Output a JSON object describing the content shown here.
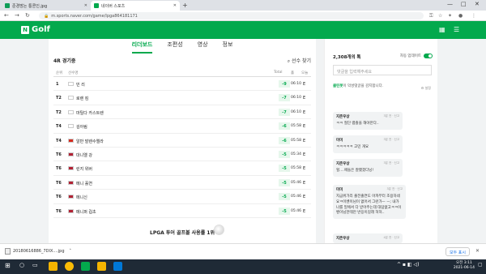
{
  "browser": {
    "tabs": [
      {
        "title": "준경방는 통쿵인.jpg",
        "favicon_color": "#0f9d58"
      },
      {
        "title": "네이버 스포츠",
        "favicon_color": "#03a94d"
      }
    ],
    "new_tab": "+",
    "url": "m.sports.naver.com/game/lpga864181171",
    "window": {
      "minimize": "—",
      "maximize": "□",
      "close": "✕"
    }
  },
  "site": {
    "logo_letter": "N",
    "logo_text": "Golf",
    "icons": [
      "calendar-icon",
      "menu-icon"
    ]
  },
  "page_tabs": [
    {
      "label": "리더보드",
      "active": true
    },
    {
      "label": "조편성",
      "active": false
    },
    {
      "label": "영상",
      "active": false
    },
    {
      "label": "정보",
      "active": false
    }
  ],
  "leaderboard": {
    "round_label": "4R 경기중",
    "find_button": "선수 찾기",
    "columns": {
      "pos": "순위",
      "player": "선수명",
      "total": "Total",
      "thru": "홀",
      "last": "오늘"
    },
    "rows": [
      {
        "pos": "1",
        "flag": "kr",
        "name": "민 리",
        "score": "-9",
        "thru": "06:10",
        "last": "E"
      },
      {
        "pos": "T2",
        "flag": "kr",
        "name": "로렌 킴",
        "score": "-7",
        "thru": "06:10",
        "last": "E"
      },
      {
        "pos": "T2",
        "flag": "fi",
        "name": "마틸다 카스트렌",
        "score": "-7",
        "thru": "06:10",
        "last": "E"
      },
      {
        "pos": "T4",
        "flag": "kr",
        "name": "김아림",
        "score": "-6",
        "thru": "05:58",
        "last": "E"
      },
      {
        "pos": "T4",
        "flag": "ch",
        "name": "알반 발렌수엘라",
        "score": "-6",
        "thru": "05:58",
        "last": "E"
      },
      {
        "pos": "T6",
        "flag": "us",
        "name": "대니엘 강",
        "score": "-5",
        "thru": "05:34",
        "last": "E"
      },
      {
        "pos": "T6",
        "flag": "us",
        "name": "린지 위버",
        "score": "-5",
        "thru": "05:58",
        "last": "E"
      },
      {
        "pos": "T6",
        "flag": "us",
        "name": "메니 홀연",
        "score": "-5",
        "thru": "05:46",
        "last": "E"
      },
      {
        "pos": "T6",
        "flag": "us",
        "name": "메니신",
        "score": "-5",
        "thru": "05:46",
        "last": "E"
      },
      {
        "pos": "T6",
        "flag": "us",
        "name": "메니퍼 컵초",
        "score": "-5",
        "thru": "05:46",
        "last": "E"
      }
    ],
    "banner": "LPGA 투어 골프볼 사용률 1위"
  },
  "chat": {
    "count": "2,308개의 톡",
    "autoscroll_label": "자동 업데이트",
    "input_placeholder": "댓글을 입력해주세요",
    "cleanbot_name": "클린봇",
    "cleanbot_text": "이 악성댓글을 감지합니다.",
    "cleanbot_setting": "설정",
    "comments": [
      {
        "nick": "지존우상",
        "meta": "3분 전 · 신고",
        "text": "ㅋㅋ 절단 램즐을 해야한다.."
      },
      {
        "nick": "미미",
        "meta": "3분 전 · 신고",
        "text": "ㅋㅋㅋㅋㅋ 고민 개요"
      },
      {
        "nick": "지존우상",
        "meta": "3분 전 · 신고",
        "text": "헐....애들은 잘했겠다닝!"
      },
      {
        "nick": "미미",
        "meta": "3분 전 · 신고",
        "text": "지금위가리 출전출연도 아까부터 조용하네요ㅋ이벤이님이 없어서 그런가ㅡ ㅡ; 내가 나를 밑에서 다 받아주는데 대답없고ㅋㅋ이벤이님한테만 반응이길래 허허.."
      },
      {
        "nick": "지존우상",
        "meta": "4분 전 · 신고",
        "text": ""
      }
    ]
  },
  "downloads": {
    "file": "20180616886_7DIX....jpg",
    "show_all": "모두 표시",
    "close": "✕"
  },
  "taskbar": {
    "time": "오전 3:11",
    "date": "2021-06-14",
    "app_colors": [
      "#f4b400",
      "#fbbc05",
      "#03a94d",
      "#0078d7",
      "#0078d7"
    ]
  }
}
